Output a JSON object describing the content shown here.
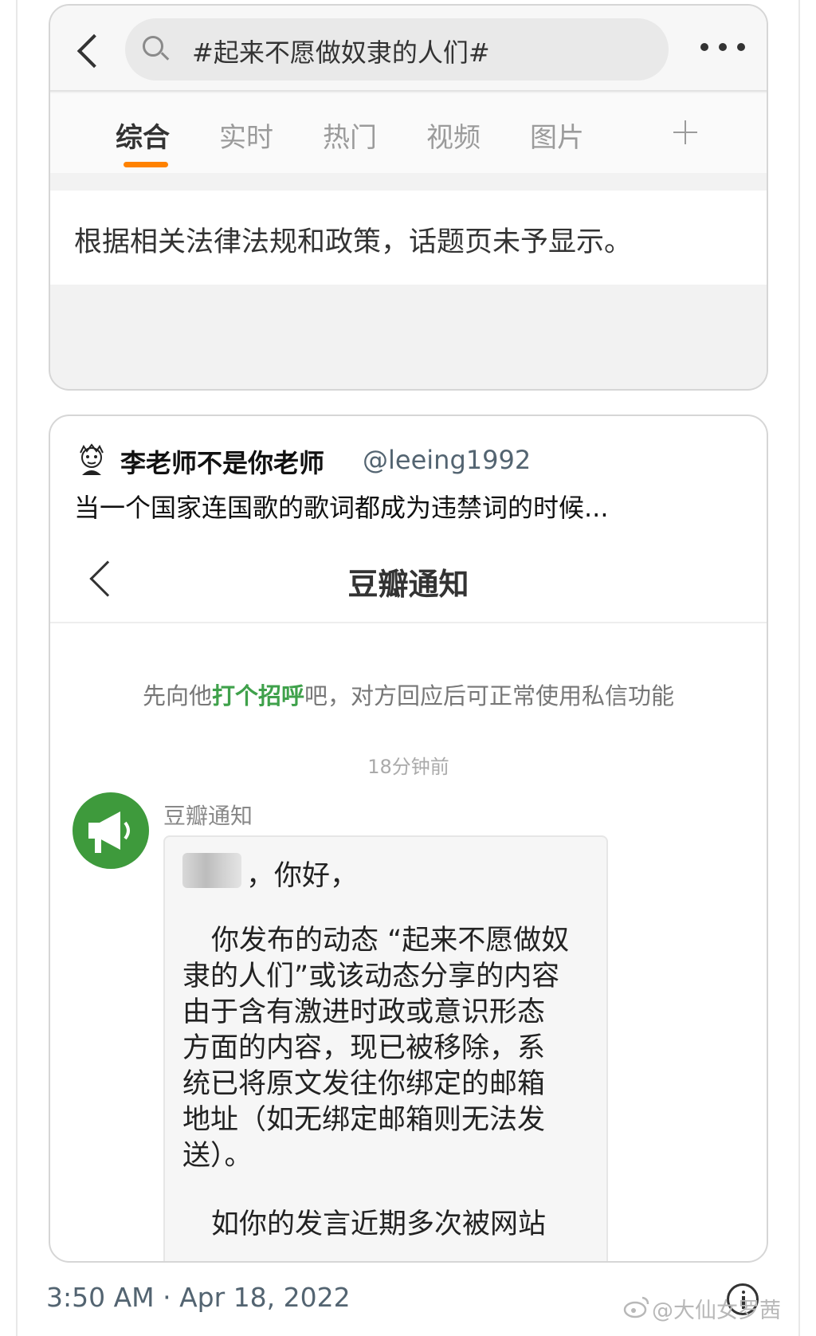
{
  "weibo": {
    "search_query": "#起来不愿做奴隶的人们#",
    "tabs": [
      "综合",
      "实时",
      "热门",
      "视频",
      "图片"
    ],
    "notice": "根据相关法律法规和政策，话题页未予显示。"
  },
  "tweet": {
    "author_name": "李老师不是你老师",
    "author_handle": "@leeing1992",
    "text": "当一个国家连国歌的歌词都成为违禁词的时候..."
  },
  "douban": {
    "title": "豆瓣通知",
    "hint_before": "先向他",
    "hint_link": "打个招呼",
    "hint_after": "吧，对方回应后可正常使用私信功能",
    "time": "18分钟前",
    "sender": "豆瓣通知",
    "greeting": "，你好，",
    "message_lines": [
      "你发布的动态 “起来不愿做奴",
      "隶的人们”或该动态分享的内容",
      "由于含有激进时政或意识形态",
      "方面的内容，现已被移除，系",
      "统已将原文发往你绑定的邮箱",
      "地址（如无绑定邮箱则无法发",
      "送）。"
    ],
    "message_line2": "如你的发言近期多次被网站"
  },
  "footer": {
    "timestamp": "3:50 AM · Apr 18, 2022",
    "watermark": "@大仙女罗茜"
  },
  "colors": {
    "weibo_accent": "#ff8200",
    "douban_green": "#3fa14b",
    "twitter_gray": "#536471"
  }
}
